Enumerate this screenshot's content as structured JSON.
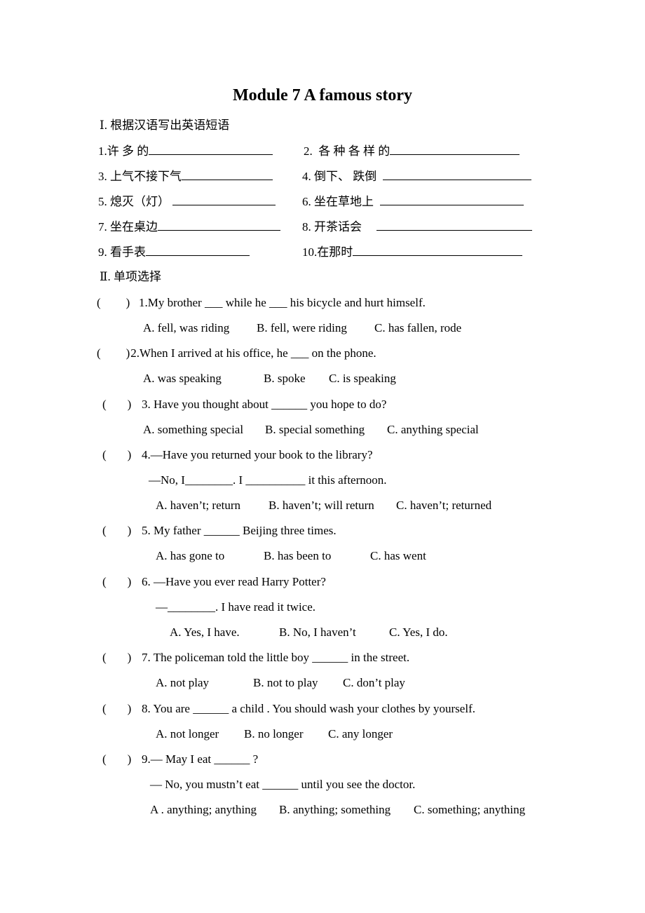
{
  "title": "Module 7 A famous story",
  "section1": {
    "heading": "Ⅰ. 根据汉语写出英语短语",
    "items": [
      {
        "num": "1.",
        "text": "许 多 的"
      },
      {
        "num": "2.",
        "text": "各 种 各 样 的"
      },
      {
        "num": "3.",
        "text": "上气不接下气"
      },
      {
        "num": "4.",
        "text": "倒下、 跌倒"
      },
      {
        "num": "5.",
        "text": "熄灭（灯）"
      },
      {
        "num": "6.",
        "text": "坐在草地上"
      },
      {
        "num": "7.",
        "text": "坐在桌边"
      },
      {
        "num": "8.",
        "text": "开茶话会"
      },
      {
        "num": "9.",
        "text": "看手表"
      },
      {
        "num": "10.",
        "text": "在那时"
      }
    ]
  },
  "section2": {
    "heading": "Ⅱ. 单项选择",
    "questions": [
      {
        "paren": "(        )",
        "stem": "1.My brother ___ while he ___ his bicycle and hurt himself.",
        "options": [
          "A. fell, was riding",
          "B. fell, were riding",
          "C. has fallen, rode"
        ]
      },
      {
        "paren": "(        )",
        "stem": "2.When I arrived at his office, he ___ on the phone.",
        "options": [
          "A. was speaking",
          "B. spoke",
          "C. is speaking"
        ]
      },
      {
        "paren": "（      ）",
        "stem": "3. Have you thought about ______ you hope to do?",
        "options": [
          "A. something special",
          "B. special something",
          "C. anything special"
        ]
      },
      {
        "paren": "（      ）",
        "stem": "4.—Have you returned your book to the library?",
        "stem2": "—No, I________. I __________ it this afternoon.",
        "options": [
          "A. haven’t; return",
          "B. haven’t; will return",
          "C. haven’t; returned"
        ]
      },
      {
        "paren": "（      ）",
        "stem": "5. My father ______ Beijing three times.",
        "options": [
          "A. has gone to",
          "B. has been to",
          "C. has went"
        ]
      },
      {
        "paren": "（      ）",
        "stem": "6. —Have you ever read Harry Potter?",
        "stem2": "—________. I have read it twice.",
        "options": [
          "A. Yes, I have.",
          "B. No, I haven’t",
          "C. Yes, I do."
        ]
      },
      {
        "paren": "（      ）",
        "stem": "7. The policeman told the little boy ______ in the street.",
        "options": [
          "A. not play",
          "B. not to play",
          "C. don’t play"
        ]
      },
      {
        "paren": "（      ）",
        "stem": "8. You are ______ a child . You should wash your clothes by yourself.",
        "options": [
          "A. not longer",
          "B. no longer",
          "C. any longer"
        ]
      },
      {
        "paren": "（      ）",
        "stem": "9.— May I eat ______ ?",
        "stem2": "— No, you mustn’t eat ______ until you see the doctor.",
        "options": [
          "A . anything; anything",
          "B. anything; something",
          "C. something; anything"
        ]
      }
    ]
  }
}
